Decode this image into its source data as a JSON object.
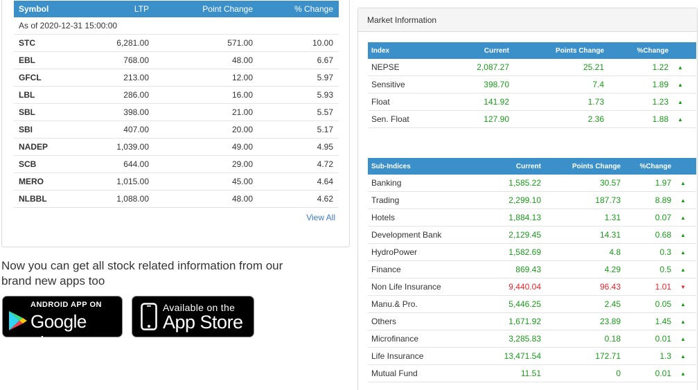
{
  "gainers": {
    "headers": {
      "symbol": "Symbol",
      "ltp": "LTP",
      "point_change": "Point Change",
      "pct_change": "% Change"
    },
    "as_of": "As of 2020-12-31 15:00:00",
    "rows": [
      {
        "symbol": "STC",
        "ltp": "6,281.00",
        "pc": "571.00",
        "pct": "10.00"
      },
      {
        "symbol": "EBL",
        "ltp": "768.00",
        "pc": "48.00",
        "pct": "6.67"
      },
      {
        "symbol": "GFCL",
        "ltp": "213.00",
        "pc": "12.00",
        "pct": "5.97"
      },
      {
        "symbol": "LBL",
        "ltp": "286.00",
        "pc": "16.00",
        "pct": "5.93"
      },
      {
        "symbol": "SBL",
        "ltp": "398.00",
        "pc": "21.00",
        "pct": "5.57"
      },
      {
        "symbol": "SBI",
        "ltp": "407.00",
        "pc": "20.00",
        "pct": "5.17"
      },
      {
        "symbol": "NADEP",
        "ltp": "1,039.00",
        "pc": "49.00",
        "pct": "4.95"
      },
      {
        "symbol": "SCB",
        "ltp": "644.00",
        "pc": "29.00",
        "pct": "4.72"
      },
      {
        "symbol": "MERO",
        "ltp": "1,015.00",
        "pc": "45.00",
        "pct": "4.64"
      },
      {
        "symbol": "NLBBL",
        "ltp": "1,088.00",
        "pc": "48.00",
        "pct": "4.62"
      }
    ],
    "view_all": "View All"
  },
  "promo": {
    "text": "Now you can get all stock related information from our brand new apps too",
    "google": {
      "small": "ANDROID APP ON",
      "big": "Google play"
    },
    "apple": {
      "small": "Available on the",
      "big": "App Store"
    }
  },
  "market_info": {
    "title": "Market Information",
    "index_headers": {
      "name": "Index",
      "current": "Current",
      "points_change": "Points Change",
      "pct_change": "%Change"
    },
    "indices": [
      {
        "name": "NEPSE",
        "current": "2,087.27",
        "pc": "25.21",
        "pct": "1.22",
        "dir": "up"
      },
      {
        "name": "Sensitive",
        "current": "398.70",
        "pc": "7.4",
        "pct": "1.89",
        "dir": "up"
      },
      {
        "name": "Float",
        "current": "141.92",
        "pc": "1.73",
        "pct": "1.23",
        "dir": "up"
      },
      {
        "name": "Sen. Float",
        "current": "127.90",
        "pc": "2.36",
        "pct": "1.88",
        "dir": "up"
      }
    ],
    "sub_headers": {
      "name": "Sub-Indices",
      "current": "Current",
      "points_change": "Points Change",
      "pct_change": "%Change"
    },
    "sub_indices": [
      {
        "name": "Banking",
        "current": "1,585.22",
        "pc": "30.57",
        "pct": "1.97",
        "dir": "up"
      },
      {
        "name": "Trading",
        "current": "2,299.10",
        "pc": "187.73",
        "pct": "8.89",
        "dir": "up"
      },
      {
        "name": "Hotels",
        "current": "1,884.13",
        "pc": "1.31",
        "pct": "0.07",
        "dir": "up"
      },
      {
        "name": "Development Bank",
        "current": "2,129.45",
        "pc": "14.31",
        "pct": "0.68",
        "dir": "up"
      },
      {
        "name": "HydroPower",
        "current": "1,582.69",
        "pc": "4.8",
        "pct": "0.3",
        "dir": "up"
      },
      {
        "name": "Finance",
        "current": "869.43",
        "pc": "4.29",
        "pct": "0.5",
        "dir": "up"
      },
      {
        "name": "Non Life Insurance",
        "current": "9,440.04",
        "pc": "96.43",
        "pct": "1.01",
        "dir": "down"
      },
      {
        "name": "Manu.& Pro.",
        "current": "5,446.25",
        "pc": "2.45",
        "pct": "0.05",
        "dir": "up"
      },
      {
        "name": "Others",
        "current": "1,671.92",
        "pc": "23.89",
        "pct": "1.45",
        "dir": "up"
      },
      {
        "name": "Microfinance",
        "current": "3,285.83",
        "pc": "0.18",
        "pct": "0.01",
        "dir": "up"
      },
      {
        "name": "Life Insurance",
        "current": "13,471.54",
        "pc": "172.71",
        "pct": "1.3",
        "dir": "up"
      },
      {
        "name": "Mutual Fund",
        "current": "11.51",
        "pc": "0",
        "pct": "0.01",
        "dir": "up"
      }
    ]
  },
  "colors": {
    "header_blue": "#3c90c9",
    "up": "#1a9a1a",
    "down": "#e0282e",
    "link": "#3c78c8"
  },
  "icons": {
    "up": "triangle-up-icon",
    "down": "triangle-down-icon"
  }
}
